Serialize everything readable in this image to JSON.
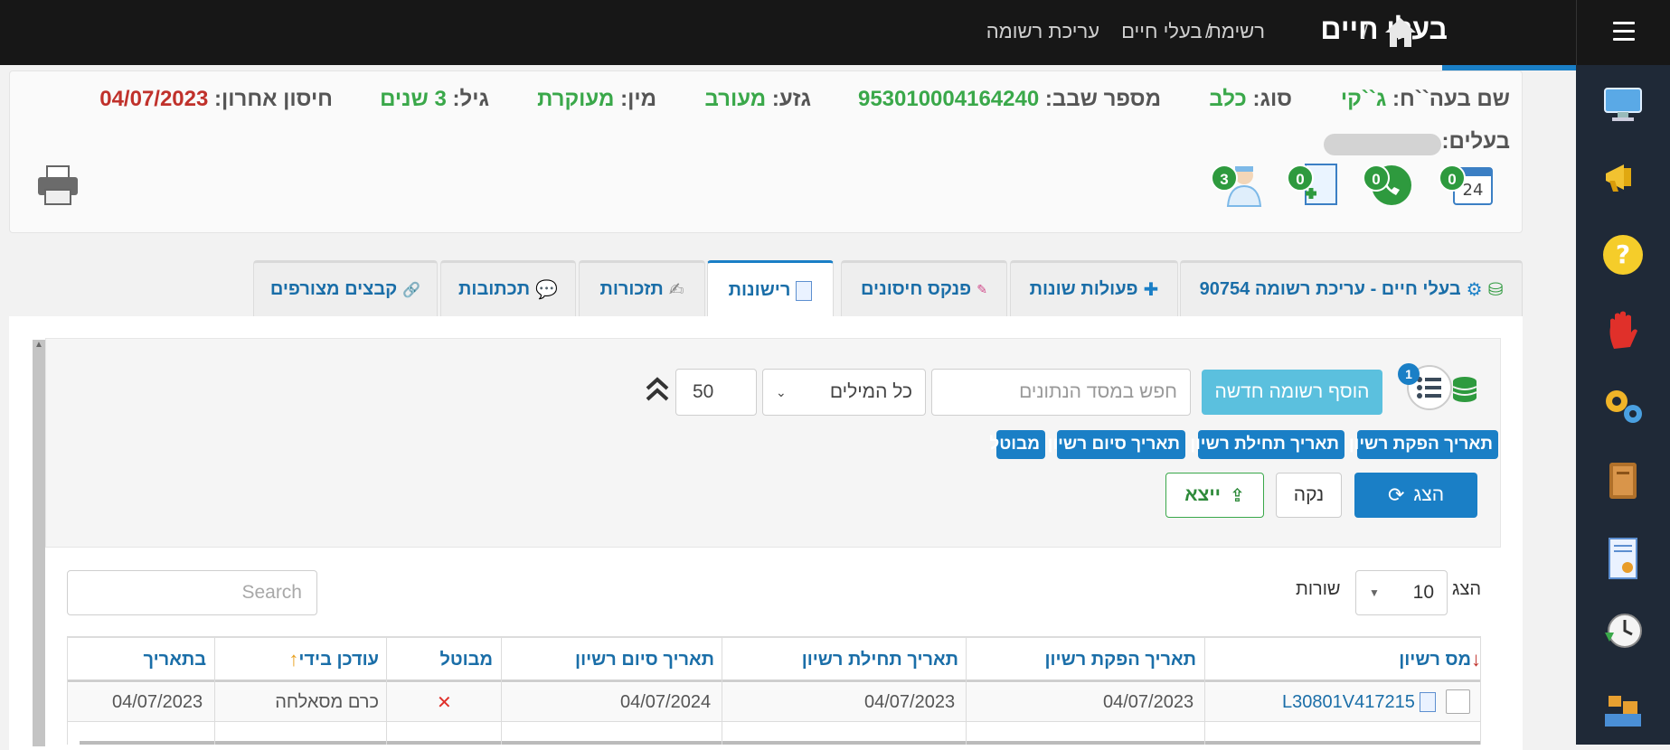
{
  "header": {
    "app_title": "בעלי חיים",
    "breadcrumbs": [
      "רשימת בעלי חיים",
      "עריכת רשומה"
    ],
    "separator": "/"
  },
  "animal_info": {
    "name_label": "שם בעה``ח:",
    "name_value": "ג``קי",
    "type_label": "סוג:",
    "type_value": "כלב",
    "chip_label": "מספר שבב:",
    "chip_value": "953010004164240",
    "breed_label": "גזע:",
    "breed_value": "מעורב",
    "sex_label": "מין:",
    "sex_value": "מעוקרת",
    "age_label": "גיל:",
    "age_value": "3 שנים",
    "last_vaccine_label": "חיסון אחרון:",
    "last_vaccine_value": "04/07/2023",
    "owners_label": "בעלים:",
    "badges": {
      "calendar": "0",
      "phone": "0",
      "add_doc": "0",
      "vet": "3"
    }
  },
  "tabs": [
    {
      "label": "בעלי חיים - עריכת רשומה 90754",
      "icon": "database-gear-icon"
    },
    {
      "label": "פעולות שונות",
      "icon": "puzzle-icon"
    },
    {
      "label": "פנקס חיסונים",
      "icon": "syringe-icon"
    },
    {
      "label": "רישונות",
      "icon": "certificate-icon",
      "active": true
    },
    {
      "label": "תזכורות",
      "icon": "reminder-icon"
    },
    {
      "label": "תכתובות",
      "icon": "chat-icon"
    },
    {
      "label": "קבצים מצורפים",
      "icon": "paperclip-icon"
    }
  ],
  "filter": {
    "list_badge": "1",
    "add_record": "הוסף רשומה חדשה",
    "search_placeholder": "חפש במסד הנתונים",
    "match_mode": "כל המילים",
    "page_size": "50",
    "chips": [
      "תאריך הפקת רשיון",
      "תאריך תחילת רשיון",
      "תאריך סיום רשיון",
      "מבוטל"
    ],
    "show": "הצג",
    "clear": "נקה",
    "export": "ייצא"
  },
  "table_controls": {
    "show_label": "הצג",
    "rows_value": "10",
    "rows_label": "שורות",
    "search_placeholder": "Search"
  },
  "table": {
    "columns": [
      "מס רשיון",
      "תאריך הפקת רשיון",
      "תאריך תחילת רשיון",
      "תאריך סיום רשיון",
      "מבוטל",
      "עודכן בידי",
      "בתאריך"
    ],
    "rows": [
      {
        "license_no": "L30801V417215",
        "issue_date": "04/07/2023",
        "start_date": "04/07/2023",
        "end_date": "04/07/2024",
        "cancelled": "✕",
        "updated_by": "כרם מסאלחה",
        "updated_on": "04/07/2023"
      }
    ]
  },
  "colors": {
    "topbar": "#171717",
    "accent": "#1a7fc6",
    "green_value": "#3aa84a",
    "red_value": "#c0312b",
    "link_blue": "#1a6ea8"
  }
}
